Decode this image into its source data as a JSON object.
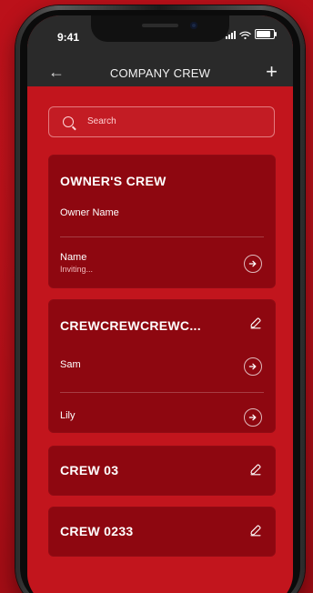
{
  "status_bar": {
    "time": "9:41"
  },
  "header": {
    "title": "COMPANY CREW"
  },
  "search": {
    "placeholder": "Search"
  },
  "cards": {
    "owner": {
      "title": "OWNER'S CREW",
      "subtitle": "Owner Name",
      "member": {
        "name": "Name",
        "status": "Inviting..."
      }
    },
    "crew1": {
      "title": "CREWCREWCREWC...",
      "members": [
        "Sam",
        "Lily"
      ]
    },
    "crew2": {
      "title": "CREW 03"
    },
    "crew3": {
      "title": "CREW 0233"
    }
  },
  "icons": {
    "back": "arrow-left-icon",
    "add": "plus-icon",
    "search": "search-icon",
    "arrow": "arrow-right-circle-icon",
    "edit": "pencil-icon",
    "wifi": "wifi-icon",
    "battery": "battery-icon",
    "signal": "signal-icon"
  },
  "colors": {
    "background": "#b9121b",
    "screen": "#c2151d",
    "card": "#8e0710",
    "topbar": "#2a2a2a",
    "text": "#ffffff"
  }
}
